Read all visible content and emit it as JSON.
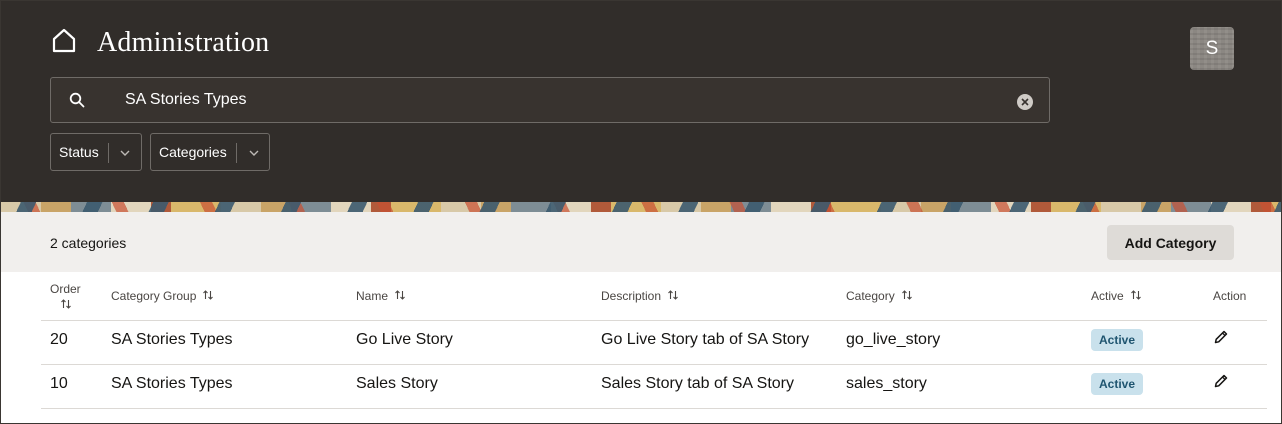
{
  "header": {
    "title": "Administration",
    "home_icon": "home-icon",
    "avatar_initial": "S"
  },
  "search": {
    "value": "SA Stories Types",
    "placeholder": "Search"
  },
  "filters": [
    {
      "label": "Status"
    },
    {
      "label": "Categories"
    }
  ],
  "toolbar": {
    "count_label": "2 categories",
    "add_label": "Add Category"
  },
  "table": {
    "headers": {
      "order": "Order",
      "category_group": "Category Group",
      "name": "Name",
      "description": "Description",
      "category": "Category",
      "active": "Active",
      "action": "Action"
    },
    "rows": [
      {
        "order": "20",
        "category_group": "SA Stories Types",
        "name": "Go Live Story",
        "description": "Go Live Story tab of SA Story",
        "category": "go_live_story",
        "active": "Active"
      },
      {
        "order": "10",
        "category_group": "SA Stories Types",
        "name": "Sales Story",
        "description": "Sales Story tab of SA Story",
        "category": "sales_story",
        "active": "Active"
      }
    ]
  },
  "colors": {
    "header_bg": "#312d2a",
    "toolbar_bg": "#f1efed",
    "badge_bg": "#c9e1ec",
    "badge_text": "#1f5570"
  }
}
